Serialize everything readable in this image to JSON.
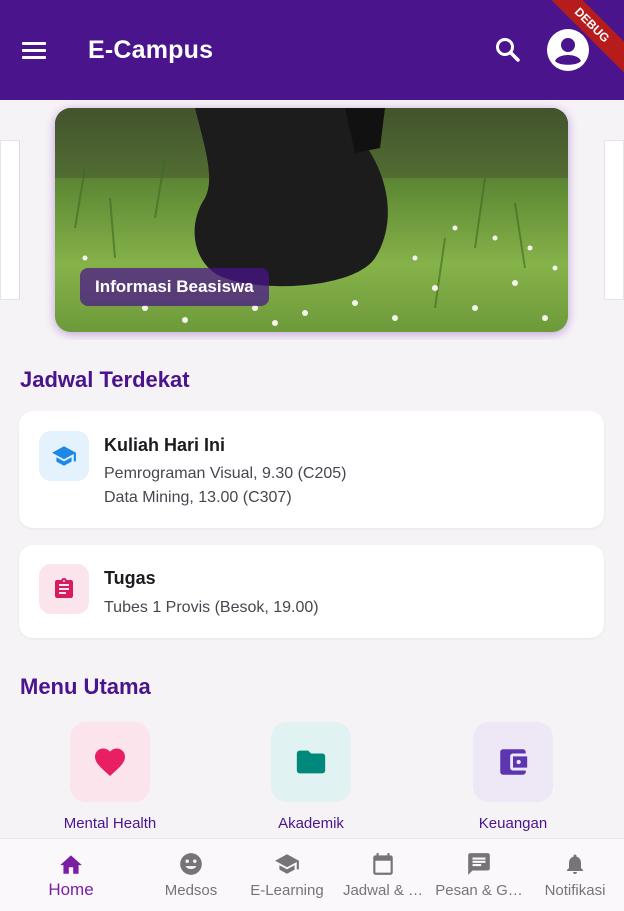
{
  "appbar": {
    "title": "E-Campus",
    "menu_icon": "menu-icon",
    "search_icon": "search-icon",
    "account_icon": "account-circle-icon",
    "debug_label": "DEBUG",
    "color": "#4a148c"
  },
  "carousel": {
    "slide_label": "Informasi Beasiswa"
  },
  "schedule": {
    "heading": "Jadwal Terdekat",
    "cards": [
      {
        "icon": "school-icon",
        "icon_bg": "#e3f2fd",
        "icon_color": "#1e88e5",
        "title": "Kuliah Hari Ini",
        "lines": [
          "Pemrograman Visual, 9.30 (C205)",
          "Data Mining, 13.00 (C307)"
        ]
      },
      {
        "icon": "assignment-icon",
        "icon_bg": "#fce4ec",
        "icon_color": "#d81b60",
        "title": "Tugas",
        "lines": [
          "Tubes 1 Provis (Besok, 19.00)"
        ]
      }
    ]
  },
  "main_menu": {
    "heading": "Menu Utama",
    "items": [
      {
        "label": "Mental Health",
        "icon": "heart-icon",
        "bg": "#fce4ec",
        "color": "#e91e63"
      },
      {
        "label": "Akademik",
        "icon": "folder-icon",
        "bg": "#e0f2f1",
        "color": "#00897b"
      },
      {
        "label": "Keuangan",
        "icon": "wallet-icon",
        "bg": "#ede7f6",
        "color": "#5e35b1"
      }
    ]
  },
  "bottom_nav": {
    "items": [
      {
        "label": "Home",
        "icon": "home-icon",
        "active": true
      },
      {
        "label": "Medsos",
        "icon": "smiley-icon",
        "active": false
      },
      {
        "label": "E-Learning",
        "icon": "school-icon",
        "active": false
      },
      {
        "label": "Jadwal & …",
        "icon": "calendar-icon",
        "active": false
      },
      {
        "label": "Pesan & G…",
        "icon": "chat-icon",
        "active": false
      },
      {
        "label": "Notifikasi",
        "icon": "bell-icon",
        "active": false
      }
    ],
    "active_color": "#7b1fa2",
    "inactive_color": "#757575"
  }
}
